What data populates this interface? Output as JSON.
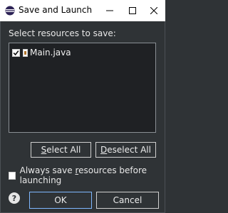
{
  "window": {
    "title": "Save and Launch",
    "minimize_label": "—",
    "maximize_label": "☐",
    "close_label": "✕"
  },
  "prompt": "Select resources to save:",
  "resources": [
    {
      "name": "Main.java",
      "checked": true
    }
  ],
  "buttons": {
    "select_all": {
      "pre": "",
      "accel": "S",
      "post": "elect All"
    },
    "deselect_all": {
      "pre": "",
      "accel": "D",
      "post": "eselect All"
    },
    "ok": "OK",
    "cancel": "Cancel"
  },
  "always_save": {
    "pre": "Always save ",
    "accel": "r",
    "post": "esources before launching",
    "checked": false
  },
  "help_label": "?"
}
